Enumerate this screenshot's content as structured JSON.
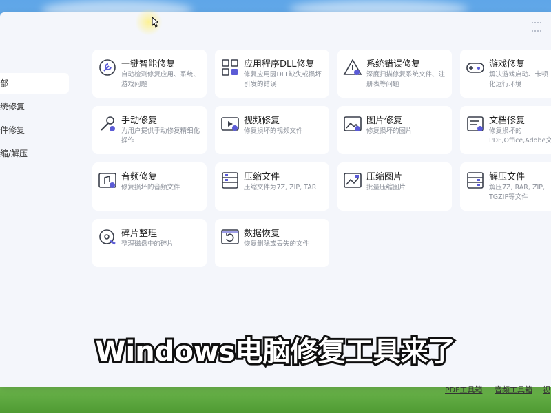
{
  "sidebar": {
    "items": [
      {
        "label": "部"
      },
      {
        "label": "统修复"
      },
      {
        "label": "件修复"
      },
      {
        "label": "缩/解压"
      }
    ]
  },
  "cards": [
    {
      "title": "一键智能修复",
      "desc": "自动检测修复应用、系统、游戏问题",
      "icon": "wrench-icon"
    },
    {
      "title": "应用程序DLL修复",
      "desc": "修复应用因DLL缺失或损坏引发的错误",
      "icon": "dll-grid-icon"
    },
    {
      "title": "系统错误修复",
      "desc": "深度扫描修复系统文件、注册表等问题",
      "icon": "warning-icon"
    },
    {
      "title": "游戏修复",
      "desc": "解决游戏启动、卡顿化运行环境",
      "icon": "gamepad-icon"
    },
    {
      "title": "手动修复",
      "desc": "为用户提供手动修复精细化操作",
      "icon": "tools-icon"
    },
    {
      "title": "视频修复",
      "desc": "修复损坏的视频文件",
      "icon": "video-icon"
    },
    {
      "title": "图片修复",
      "desc": "修复损坏的图片",
      "icon": "image-icon"
    },
    {
      "title": "文档修复",
      "desc": "修复损坏的PDF,Office,Adobe文",
      "icon": "document-icon"
    },
    {
      "title": "音频修复",
      "desc": "修复损坏的音频文件",
      "icon": "audio-icon"
    },
    {
      "title": "压缩文件",
      "desc": "压缩文件为7Z, ZIP, TAR",
      "icon": "archive-icon"
    },
    {
      "title": "压缩图片",
      "desc": "批量压缩图片",
      "icon": "compress-image-icon"
    },
    {
      "title": "解压文件",
      "desc": "解压7Z, RAR, ZIP, TGZIP等文件",
      "icon": "extract-icon"
    },
    {
      "title": "碎片整理",
      "desc": "整理磁盘中的碎片",
      "icon": "disk-icon"
    },
    {
      "title": "数据恢复",
      "desc": "恢复删除或丢失的文件",
      "icon": "recover-icon"
    }
  ],
  "subtitle": "Windows电脑修复工具来了",
  "footer": {
    "pdf_toolbox": "PDF工具箱",
    "audio_toolbox": "音频工具箱",
    "video_toolbox": "视"
  },
  "colors": {
    "accent": "#5b5bd6",
    "icon_stroke": "#3a3f4b"
  }
}
